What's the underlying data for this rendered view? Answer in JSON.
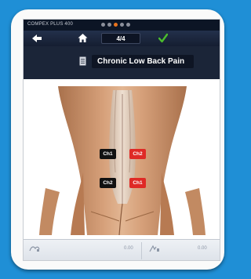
{
  "statusbar": {
    "device_label": "COMPEX PLUS 400",
    "dots": [
      false,
      false,
      true,
      false,
      false
    ]
  },
  "toolbar": {
    "page_counter": "4/4"
  },
  "program": {
    "title": "Chronic Low Back Pain"
  },
  "electrodes": [
    {
      "label": "Ch1",
      "color": "black"
    },
    {
      "label": "Ch2",
      "color": "red"
    },
    {
      "label": "Ch2",
      "color": "black"
    },
    {
      "label": "Ch1",
      "color": "red"
    }
  ],
  "footer": {
    "left_value": "0.00",
    "right_value": "0.00"
  },
  "colors": {
    "background": "#1f8fd6",
    "header": "#1b2538",
    "accent_check": "#4bbd2d",
    "status_dot_active": "#e8731c",
    "channel_red": "#df2a26"
  }
}
